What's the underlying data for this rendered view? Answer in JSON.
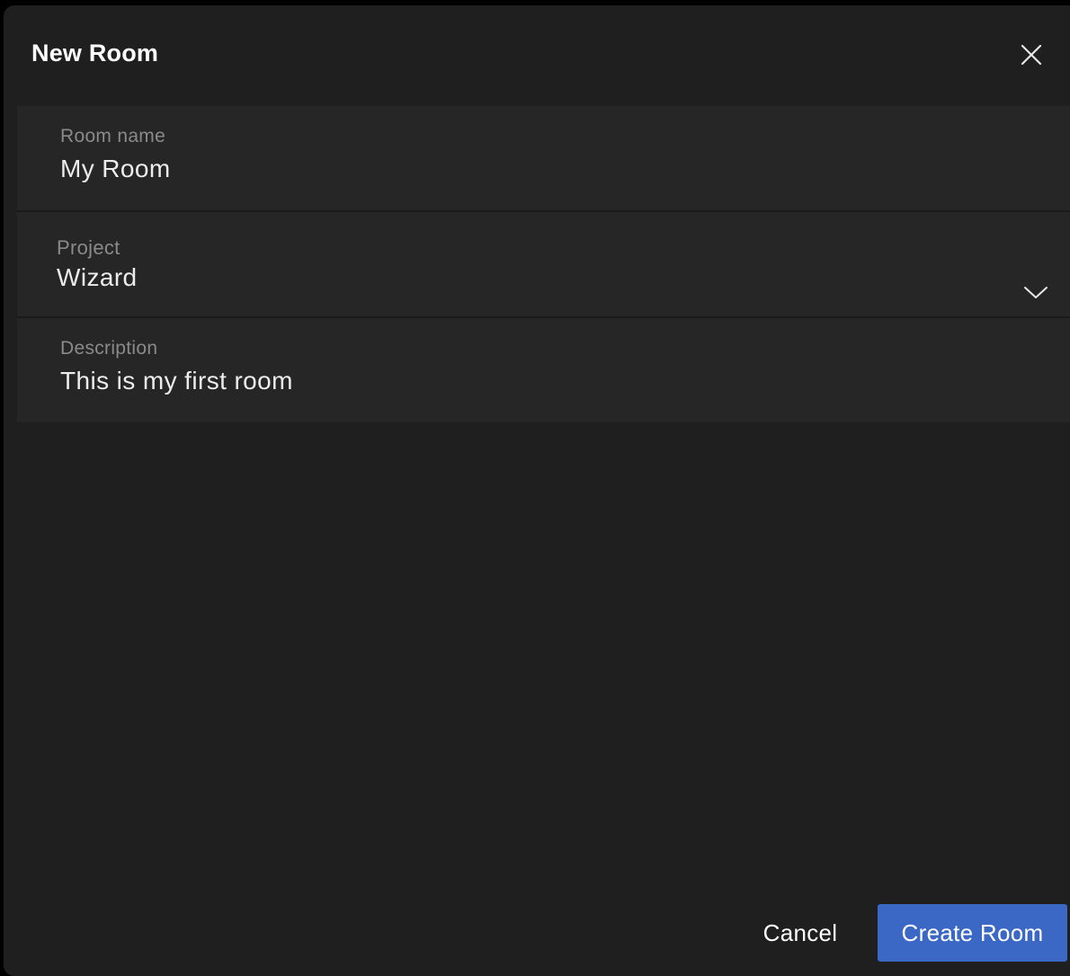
{
  "dialog": {
    "title": "New Room",
    "close_icon": "close-icon"
  },
  "form": {
    "room_name": {
      "label": "Room name",
      "value": "My Room"
    },
    "project": {
      "label": "Project",
      "value": "Wizard",
      "dropdown_icon": "chevron-down-icon"
    },
    "description": {
      "label": "Description",
      "value": "This is my first room"
    }
  },
  "actions": {
    "cancel_label": "Cancel",
    "create_label": "Create Room"
  },
  "colors": {
    "background": "#1f1f1f",
    "field_background": "#262626",
    "primary_button": "#3b68c4",
    "label_text": "#8a8a8a",
    "value_text": "#ececec"
  }
}
